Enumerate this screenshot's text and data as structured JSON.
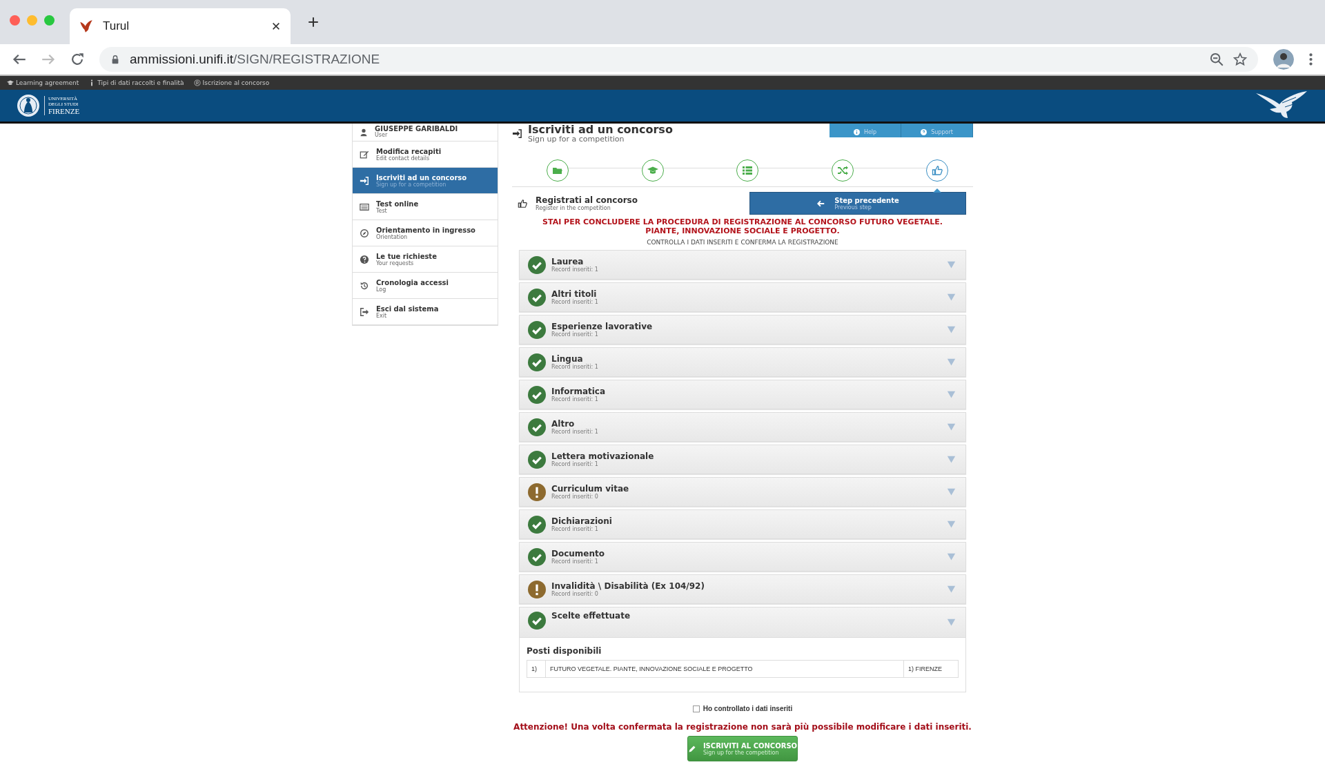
{
  "browser": {
    "tab_title": "Turul",
    "url_host": "ammissioni.unifi.it",
    "url_path": "/SIGN/REGISTRAZIONE"
  },
  "top_links": [
    {
      "label": "Learning agreement"
    },
    {
      "label": "Tipi di dati raccolti e finalità"
    },
    {
      "label": "Iscrizione al concorso"
    }
  ],
  "logo": {
    "lines": [
      "UNIVERSITÀ",
      "DEGLI STUDI",
      "FIRENZE"
    ]
  },
  "sidebar": {
    "user": {
      "name": "GIUSEPPE GARIBALDI",
      "role": "User"
    },
    "items": [
      {
        "label": "Modifica recapiti",
        "sublabel": "Edit contact details",
        "selected": false
      },
      {
        "label": "Iscriviti ad un concorso",
        "sublabel": "Sign up for a competition",
        "selected": true
      },
      {
        "label": "Test online",
        "sublabel": "Test",
        "selected": false
      },
      {
        "label": "Orientamento in ingresso",
        "sublabel": "Orientation",
        "selected": false
      },
      {
        "label": "Le tue richieste",
        "sublabel": "Your requests",
        "selected": false
      },
      {
        "label": "Cronologia accessi",
        "sublabel": "Log",
        "selected": false
      },
      {
        "label": "Esci dal sistema",
        "sublabel": "Exit",
        "selected": false
      }
    ]
  },
  "page": {
    "title": "Iscriviti ad un concorso",
    "subtitle": "Sign up for a competition",
    "help_buttons": [
      {
        "label": "Help"
      },
      {
        "label": "Support"
      }
    ]
  },
  "steps": [
    {
      "selected": false
    },
    {
      "selected": false
    },
    {
      "selected": false
    },
    {
      "selected": false
    },
    {
      "selected": true
    }
  ],
  "section": {
    "title": "Registrati al concorso",
    "subtitle": "Register in the competition",
    "back_button": {
      "label": "Step precedente",
      "sublabel": "Previous step"
    }
  },
  "notice": "STAI PER CONCLUDERE LA PROCEDURA DI REGISTRAZIONE AL CONCORSO FUTURO VEGETALE. PIANTE, INNOVAZIONE SOCIALE E PROGETTO.",
  "instruction": "CONTROLLA I DATI INSERITI E CONFERMA LA REGISTRAZIONE",
  "checks": [
    {
      "title": "Laurea",
      "records": "Record inseriti: 1",
      "kind": "ok",
      "expanded": false
    },
    {
      "title": "Altri titoli",
      "records": "Record inseriti: 1",
      "kind": "ok",
      "expanded": false
    },
    {
      "title": "Esperienze lavorative",
      "records": "Record inseriti: 1",
      "kind": "ok",
      "expanded": false
    },
    {
      "title": "Lingua",
      "records": "Record inseriti: 1",
      "kind": "ok",
      "expanded": false
    },
    {
      "title": "Informatica",
      "records": "Record inseriti: 1",
      "kind": "ok",
      "expanded": false
    },
    {
      "title": "Altro",
      "records": "Record inseriti: 1",
      "kind": "ok",
      "expanded": false
    },
    {
      "title": "Lettera motivazionale",
      "records": "Record inseriti: 1",
      "kind": "ok",
      "expanded": false
    },
    {
      "title": "Curriculum vitae",
      "records": "Record inseriti: 0",
      "kind": "warning",
      "expanded": false
    },
    {
      "title": "Dichiarazioni",
      "records": "Record inseriti: 1",
      "kind": "ok",
      "expanded": false
    },
    {
      "title": "Documento",
      "records": "Record inseriti: 1",
      "kind": "ok",
      "expanded": false
    },
    {
      "title": "Invalidità \\ Disabilità (Ex 104/92)",
      "records": "Record inseriti: 0",
      "kind": "warning",
      "expanded": false
    },
    {
      "title": "Scelte effettuate",
      "kind": "ok",
      "expanded": true
    }
  ],
  "choices": {
    "heading": "Posti disponibili",
    "rows": [
      {
        "index": "1)",
        "name": "FUTURO VEGETALE. PIANTE, INNOVAZIONE SOCIALE E PROGETTO",
        "site": "1) FIRENZE"
      }
    ]
  },
  "confirm_checkbox": {
    "label": "Ho controllato i dati inseriti",
    "checked": false
  },
  "warning": "Attenzione! Una volta confermata la registrazione non sarà più possibile modificare i dati inseriti.",
  "submit": {
    "label": "ISCRIVITI AL CONCORSO",
    "sublabel": "Sign up for the competition"
  }
}
